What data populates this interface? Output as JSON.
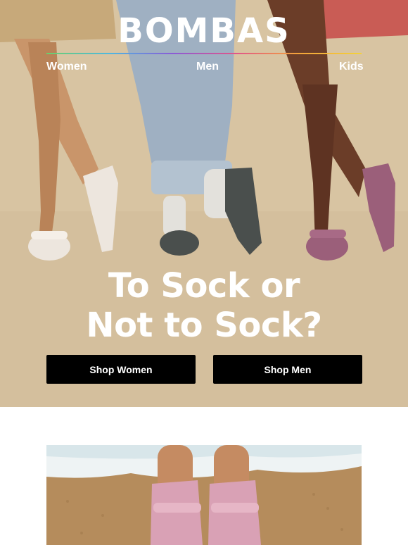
{
  "brand": {
    "logo_text": "BOMBAS"
  },
  "nav": {
    "items": [
      {
        "label": "Women"
      },
      {
        "label": "Men"
      },
      {
        "label": "Kids"
      }
    ]
  },
  "hero": {
    "headline_line1": "To Sock or",
    "headline_line2": "Not to Sock?",
    "background_color": "#d8c4a2",
    "image_description_icon": "three-people-wearing-slides-photo"
  },
  "cta": {
    "shop_women_label": "Shop Women",
    "shop_men_label": "Shop Men"
  },
  "second_section": {
    "image_icon": "feet-in-pink-slides-on-beach-photo"
  },
  "colors": {
    "button_bg": "#000000",
    "button_text": "#ffffff",
    "slide_white": "#ede6de",
    "slide_charcoal": "#4a4f4d",
    "slide_mauve": "#9b5f7a",
    "slide_pink": "#d9a1b5"
  }
}
